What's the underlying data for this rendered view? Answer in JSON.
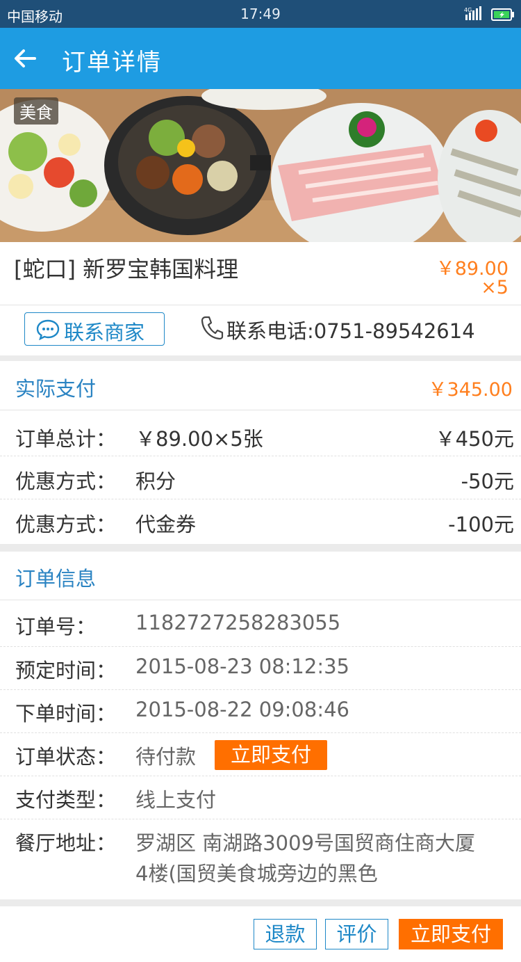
{
  "status_bar": {
    "carrier": "中国移动",
    "time": "17:49",
    "network": "4G"
  },
  "app_bar": {
    "title": "订单详情",
    "back_icon": "arrow-left-icon"
  },
  "banner": {
    "tag": "美食"
  },
  "shop": {
    "name": "[蛇口] 新罗宝韩国料理",
    "price": "￥89.00",
    "quantity": "×5"
  },
  "contact": {
    "merchant_button": "联系商家",
    "phone_text": "联系电话:0751-89542614"
  },
  "payment": {
    "title": "实际支付",
    "amount": "￥345.00",
    "rows": [
      {
        "label": "订单总计：",
        "detail": "￥89.00×5张",
        "value": "￥450元"
      },
      {
        "label": "优惠方式：",
        "detail": "积分",
        "value": "-50元"
      },
      {
        "label": "优惠方式：",
        "detail": "代金券",
        "value": "-100元"
      }
    ]
  },
  "order_info": {
    "title": "订单信息",
    "order_no_label": "订单号：",
    "order_no": "1182727258283055",
    "reserve_time_label": "预定时间：",
    "reserve_time": "2015-08-23 08:12:35",
    "order_time_label": "下单时间：",
    "order_time": "2015-08-22 09:08:46",
    "status_label": "订单状态：",
    "status": "待付款",
    "pay_now_inline": "立即支付",
    "pay_type_label": "支付类型：",
    "pay_type": "线上支付",
    "address_label": "餐厅地址：",
    "address_line1": "罗湖区 南湖路3009号国贸商住商大厦",
    "address_line2": "4楼(国贸美食城旁边的黑色"
  },
  "actions": {
    "refund": "退款",
    "review": "评价",
    "pay_now": "立即支付"
  },
  "colors": {
    "primary": "#1e9ce2",
    "status_bar": "#1f4f78",
    "accent_orange": "#ff7f1e",
    "link_blue": "#2a83c2"
  }
}
